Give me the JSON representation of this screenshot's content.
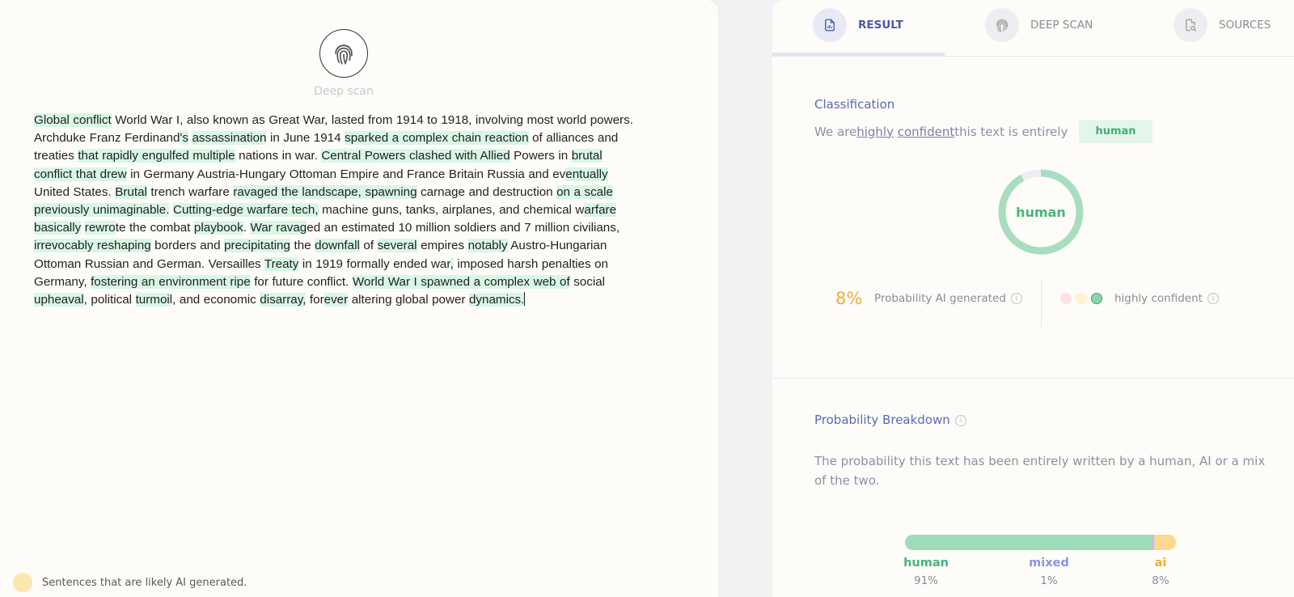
{
  "left": {
    "scan_label": "Deep scan",
    "legend_text": "Sentences that are likely AI generated.",
    "essay_segments": [
      {
        "t": "Global conflict",
        "h": true
      },
      {
        "t": " World War I, also known as Great War, lasted from 1914 to 1918, involving most world powers. Archduke Franz Ferdinand",
        "h": false
      },
      {
        "t": "'s",
        "h": true
      },
      {
        "t": " ",
        "h": false
      },
      {
        "t": "assassination",
        "h": true
      },
      {
        "t": " in June 1914 ",
        "h": false
      },
      {
        "t": "sparked a complex chain reaction",
        "h": true
      },
      {
        "t": " of alliances and treaties ",
        "h": false
      },
      {
        "t": "that rapidly engulfed multiple",
        "h": true
      },
      {
        "t": " nations in war. ",
        "h": false
      },
      {
        "t": "Central Powers clashed with Allied",
        "h": true
      },
      {
        "t": " Powers in ",
        "h": false
      },
      {
        "t": "brutal conflict that drew",
        "h": true
      },
      {
        "t": " in Germany Austria-Hungary Ottoman Empire and France Britain Russia and ev",
        "h": false
      },
      {
        "t": "entually",
        "h": true
      },
      {
        "t": " United States. ",
        "h": false
      },
      {
        "t": "Brutal",
        "h": true
      },
      {
        "t": " trench warfare ",
        "h": false
      },
      {
        "t": "ravaged the landscape, spawning",
        "h": true
      },
      {
        "t": " carnage and destruction ",
        "h": false
      },
      {
        "t": "on a scale previously unimaginable.",
        "h": true
      },
      {
        "t": " ",
        "h": false
      },
      {
        "t": "Cutting-edge warfare tech,",
        "h": true
      },
      {
        "t": " machine guns, tanks, airplanes, and chemical w",
        "h": false
      },
      {
        "t": "arfare basically",
        "h": true
      },
      {
        "t": " ",
        "h": false
      },
      {
        "t": "rewro",
        "h": true
      },
      {
        "t": "te the combat ",
        "h": false
      },
      {
        "t": "playbook",
        "h": true
      },
      {
        "t": ". ",
        "h": false
      },
      {
        "t": "War ravag",
        "h": true
      },
      {
        "t": "ed an estimated 10 million soldiers and 7 million civilians, ",
        "h": false
      },
      {
        "t": "irrevocably reshaping",
        "h": true
      },
      {
        "t": " borders and ",
        "h": false
      },
      {
        "t": "precipitating",
        "h": true
      },
      {
        "t": " the ",
        "h": false
      },
      {
        "t": "downfall",
        "h": true
      },
      {
        "t": " of ",
        "h": false
      },
      {
        "t": "several",
        "h": true
      },
      {
        "t": " empires ",
        "h": false
      },
      {
        "t": "notably",
        "h": true
      },
      {
        "t": " Austro-Hungarian Ottoman Russian and German. Versailles ",
        "h": false
      },
      {
        "t": "Treaty",
        "h": true
      },
      {
        "t": " in 1919 formally ended war",
        "h": false
      },
      {
        "t": ",",
        "h": true
      },
      {
        "t": " imposed harsh penalties on Germany, ",
        "h": false
      },
      {
        "t": "fostering an environment ripe",
        "h": true
      },
      {
        "t": " for future conflict. ",
        "h": false
      },
      {
        "t": "World War I spawned a complex web of",
        "h": true
      },
      {
        "t": " social ",
        "h": false
      },
      {
        "t": "upheaval",
        "h": true
      },
      {
        "t": ", political ",
        "h": false
      },
      {
        "t": "turmoi",
        "h": true
      },
      {
        "t": "l, and economic ",
        "h": false
      },
      {
        "t": "disarray,",
        "h": true
      },
      {
        "t": " for",
        "h": false
      },
      {
        "t": "ever",
        "h": true
      },
      {
        "t": " altering global power ",
        "h": false
      },
      {
        "t": "dynamics.",
        "h": true
      }
    ]
  },
  "tabs": [
    {
      "label": "RESULT",
      "icon": "document-chart-icon",
      "active": true
    },
    {
      "label": "DEEP SCAN",
      "icon": "fingerprint-icon",
      "active": false
    },
    {
      "label": "SOURCES",
      "icon": "document-search-icon",
      "active": false
    }
  ],
  "classification": {
    "title": "Classification",
    "sentence_prefix": "We are ",
    "word_highly": "highly",
    "word_confident": "confident",
    "sentence_suffix": " this text is entirely",
    "badge": "human",
    "donut_label": "human",
    "donut_fraction": 0.92,
    "ai_percent": "8%",
    "prob_label": "Probability AI generated",
    "confidence_label": "highly confident",
    "colors": {
      "human": "#9fdcb9",
      "mixed": "#b9bff0",
      "ai": "#fcd98d",
      "accent": "#4a57b0",
      "pink": "#fde1e4",
      "yellow": "#fdf1cf",
      "green": "#8dd6ad"
    }
  },
  "breakdown": {
    "title": "Probability Breakdown",
    "description": "The probability this text has been entirely written by a human, AI or a mix of the two.",
    "items": [
      {
        "label": "human",
        "value": "91%",
        "fraction": 0.91,
        "color": "#9fdcb9",
        "text_color": "#45b67a"
      },
      {
        "label": "mixed",
        "value": "1%",
        "fraction": 0.01,
        "color": "#b9bff0",
        "text_color": "#8a93e4"
      },
      {
        "label": "ai",
        "value": "8%",
        "fraction": 0.08,
        "color": "#fcd98d",
        "text_color": "#f2ad35"
      }
    ]
  }
}
